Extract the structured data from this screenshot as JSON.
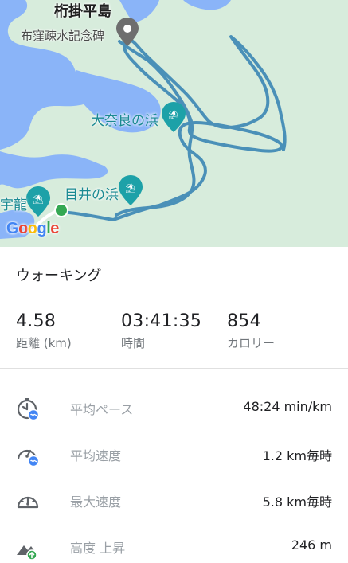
{
  "map": {
    "place_island": "桁掛平島",
    "place_monument": "布窪疎水記念碑",
    "place_beach_onara": "大奈良の浜",
    "place_beach_mei": "目井の浜",
    "place_partial": "宇龍",
    "google_logo": "Google",
    "colors": {
      "water": "#8ab4f8",
      "land": "#d7ecdc",
      "track": "#4a90b8",
      "pin_teal": "#1da1a8",
      "start_dot": "#34a853"
    }
  },
  "activity": {
    "title": "ウォーキング"
  },
  "stats": {
    "distance": {
      "value": "4.58",
      "label": "距離 (km)"
    },
    "time": {
      "value": "03:41:35",
      "label": "時間"
    },
    "calories": {
      "value": "854",
      "label": "カロリー"
    }
  },
  "details": [
    {
      "icon": "pace-icon",
      "label": "平均ペース",
      "value": "48:24 min/km"
    },
    {
      "icon": "avg-speed-icon",
      "label": "平均速度",
      "value": "1.2 km毎時"
    },
    {
      "icon": "max-speed-icon",
      "label": "最大速度",
      "value": "5.8 km毎時"
    },
    {
      "icon": "elevation-gain-icon",
      "label": "高度 上昇",
      "value": "246 m"
    }
  ]
}
